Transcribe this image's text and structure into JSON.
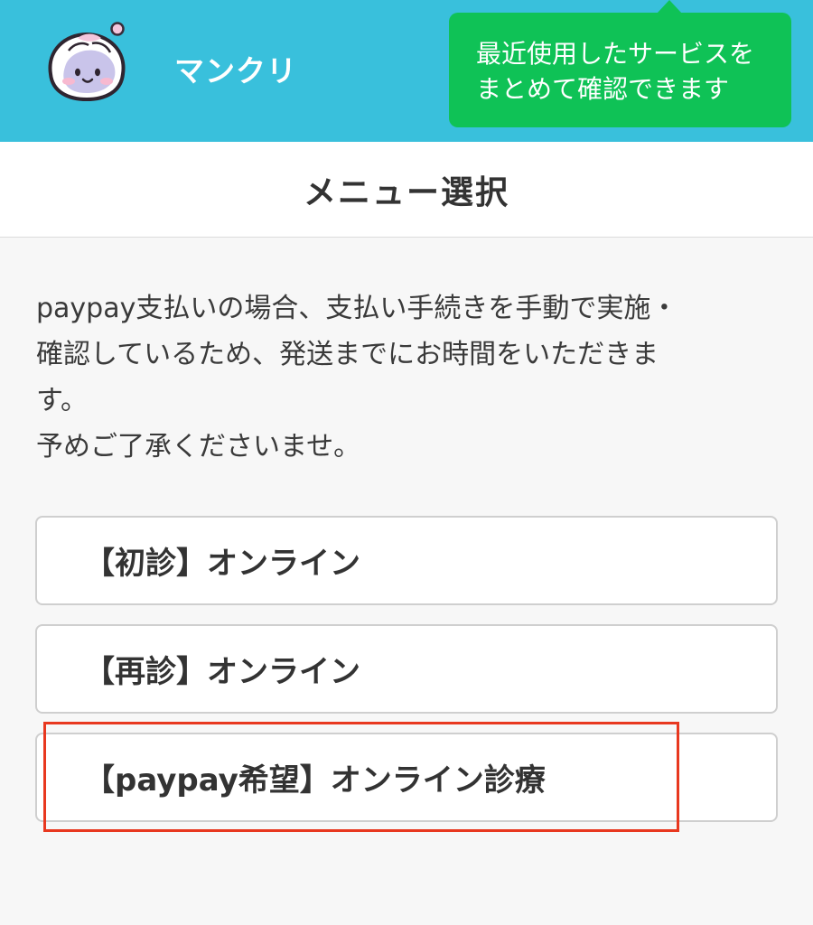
{
  "header": {
    "brand": "マンクリ",
    "avatar_icon": "mochi-mascot-icon",
    "background_color": "#39c0dc"
  },
  "tooltip": {
    "line1": "最近使用したサービスを",
    "line2": "まとめて確認できます",
    "color": "#0fc256"
  },
  "page": {
    "title": "メニュー選択"
  },
  "notice": {
    "line1": "paypay支払いの場合、支払い手続きを手動で実施・",
    "line2": "確認しているため、発送までにお時間をいただきま",
    "line3": "す。",
    "line4": "予めご了承くださいませ。"
  },
  "menu": {
    "items": [
      {
        "label": "【初診】オンライン"
      },
      {
        "label": "【再診】オンライン"
      },
      {
        "label": "【paypay希望】オンライン診療"
      }
    ]
  },
  "annotation": {
    "highlight_color": "#e8381f"
  }
}
